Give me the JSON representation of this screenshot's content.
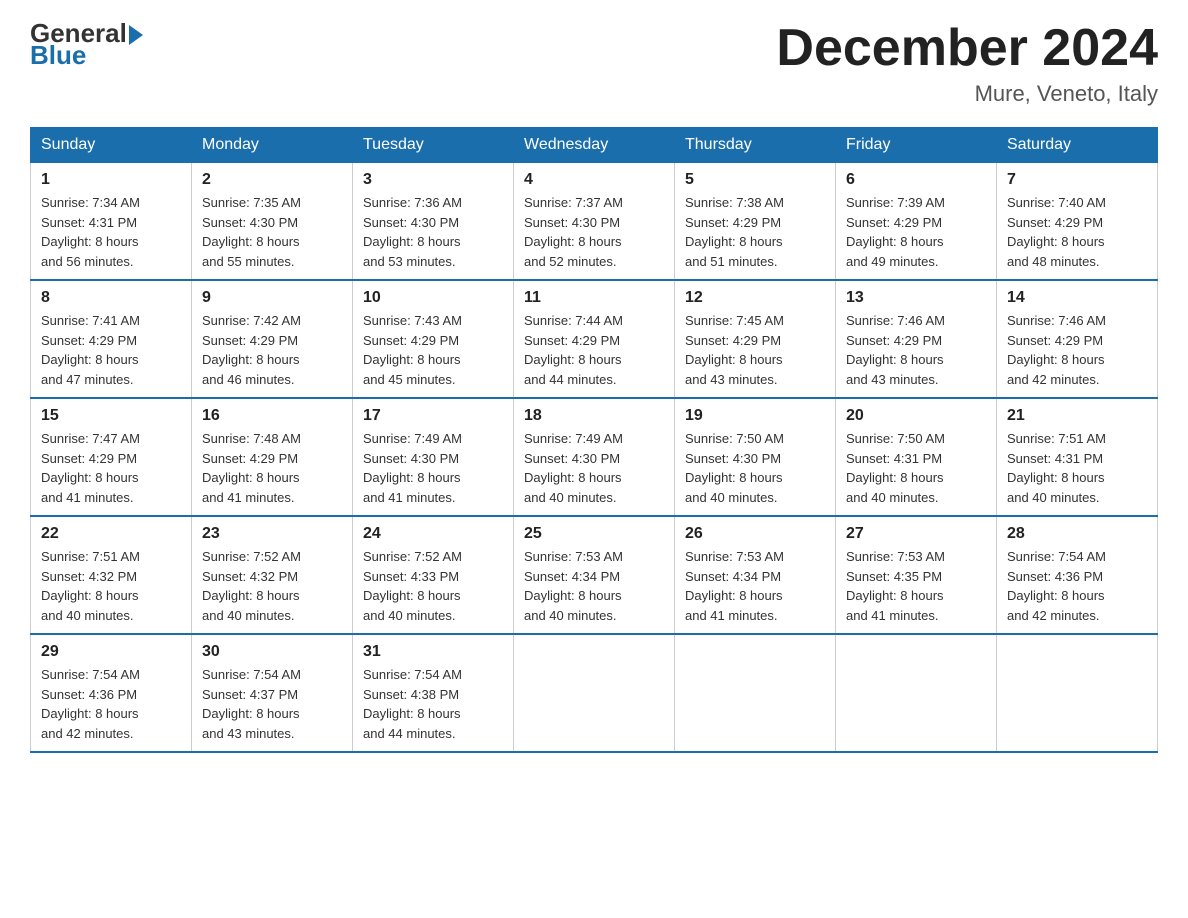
{
  "header": {
    "logo_general": "General",
    "logo_blue": "Blue",
    "month_title": "December 2024",
    "location": "Mure, Veneto, Italy"
  },
  "calendar": {
    "days_of_week": [
      "Sunday",
      "Monday",
      "Tuesday",
      "Wednesday",
      "Thursday",
      "Friday",
      "Saturday"
    ],
    "weeks": [
      [
        {
          "day": "1",
          "sunrise": "7:34 AM",
          "sunset": "4:31 PM",
          "daylight": "8 hours and 56 minutes."
        },
        {
          "day": "2",
          "sunrise": "7:35 AM",
          "sunset": "4:30 PM",
          "daylight": "8 hours and 55 minutes."
        },
        {
          "day": "3",
          "sunrise": "7:36 AM",
          "sunset": "4:30 PM",
          "daylight": "8 hours and 53 minutes."
        },
        {
          "day": "4",
          "sunrise": "7:37 AM",
          "sunset": "4:30 PM",
          "daylight": "8 hours and 52 minutes."
        },
        {
          "day": "5",
          "sunrise": "7:38 AM",
          "sunset": "4:29 PM",
          "daylight": "8 hours and 51 minutes."
        },
        {
          "day": "6",
          "sunrise": "7:39 AM",
          "sunset": "4:29 PM",
          "daylight": "8 hours and 49 minutes."
        },
        {
          "day": "7",
          "sunrise": "7:40 AM",
          "sunset": "4:29 PM",
          "daylight": "8 hours and 48 minutes."
        }
      ],
      [
        {
          "day": "8",
          "sunrise": "7:41 AM",
          "sunset": "4:29 PM",
          "daylight": "8 hours and 47 minutes."
        },
        {
          "day": "9",
          "sunrise": "7:42 AM",
          "sunset": "4:29 PM",
          "daylight": "8 hours and 46 minutes."
        },
        {
          "day": "10",
          "sunrise": "7:43 AM",
          "sunset": "4:29 PM",
          "daylight": "8 hours and 45 minutes."
        },
        {
          "day": "11",
          "sunrise": "7:44 AM",
          "sunset": "4:29 PM",
          "daylight": "8 hours and 44 minutes."
        },
        {
          "day": "12",
          "sunrise": "7:45 AM",
          "sunset": "4:29 PM",
          "daylight": "8 hours and 43 minutes."
        },
        {
          "day": "13",
          "sunrise": "7:46 AM",
          "sunset": "4:29 PM",
          "daylight": "8 hours and 43 minutes."
        },
        {
          "day": "14",
          "sunrise": "7:46 AM",
          "sunset": "4:29 PM",
          "daylight": "8 hours and 42 minutes."
        }
      ],
      [
        {
          "day": "15",
          "sunrise": "7:47 AM",
          "sunset": "4:29 PM",
          "daylight": "8 hours and 41 minutes."
        },
        {
          "day": "16",
          "sunrise": "7:48 AM",
          "sunset": "4:29 PM",
          "daylight": "8 hours and 41 minutes."
        },
        {
          "day": "17",
          "sunrise": "7:49 AM",
          "sunset": "4:30 PM",
          "daylight": "8 hours and 41 minutes."
        },
        {
          "day": "18",
          "sunrise": "7:49 AM",
          "sunset": "4:30 PM",
          "daylight": "8 hours and 40 minutes."
        },
        {
          "day": "19",
          "sunrise": "7:50 AM",
          "sunset": "4:30 PM",
          "daylight": "8 hours and 40 minutes."
        },
        {
          "day": "20",
          "sunrise": "7:50 AM",
          "sunset": "4:31 PM",
          "daylight": "8 hours and 40 minutes."
        },
        {
          "day": "21",
          "sunrise": "7:51 AM",
          "sunset": "4:31 PM",
          "daylight": "8 hours and 40 minutes."
        }
      ],
      [
        {
          "day": "22",
          "sunrise": "7:51 AM",
          "sunset": "4:32 PM",
          "daylight": "8 hours and 40 minutes."
        },
        {
          "day": "23",
          "sunrise": "7:52 AM",
          "sunset": "4:32 PM",
          "daylight": "8 hours and 40 minutes."
        },
        {
          "day": "24",
          "sunrise": "7:52 AM",
          "sunset": "4:33 PM",
          "daylight": "8 hours and 40 minutes."
        },
        {
          "day": "25",
          "sunrise": "7:53 AM",
          "sunset": "4:34 PM",
          "daylight": "8 hours and 40 minutes."
        },
        {
          "day": "26",
          "sunrise": "7:53 AM",
          "sunset": "4:34 PM",
          "daylight": "8 hours and 41 minutes."
        },
        {
          "day": "27",
          "sunrise": "7:53 AM",
          "sunset": "4:35 PM",
          "daylight": "8 hours and 41 minutes."
        },
        {
          "day": "28",
          "sunrise": "7:54 AM",
          "sunset": "4:36 PM",
          "daylight": "8 hours and 42 minutes."
        }
      ],
      [
        {
          "day": "29",
          "sunrise": "7:54 AM",
          "sunset": "4:36 PM",
          "daylight": "8 hours and 42 minutes."
        },
        {
          "day": "30",
          "sunrise": "7:54 AM",
          "sunset": "4:37 PM",
          "daylight": "8 hours and 43 minutes."
        },
        {
          "day": "31",
          "sunrise": "7:54 AM",
          "sunset": "4:38 PM",
          "daylight": "8 hours and 44 minutes."
        },
        null,
        null,
        null,
        null
      ]
    ]
  }
}
